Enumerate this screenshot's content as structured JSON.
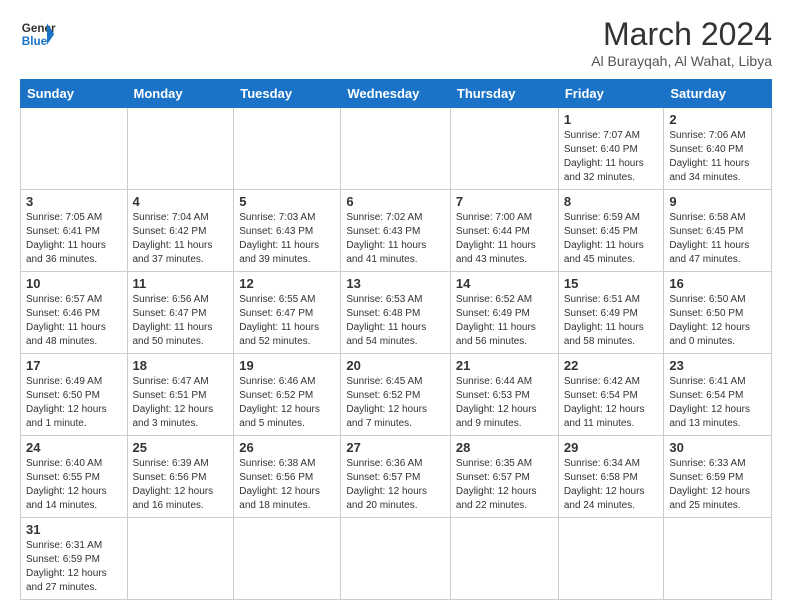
{
  "header": {
    "logo_general": "General",
    "logo_blue": "Blue",
    "month_title": "March 2024",
    "subtitle": "Al Burayqah, Al Wahat, Libya"
  },
  "days_of_week": [
    "Sunday",
    "Monday",
    "Tuesday",
    "Wednesday",
    "Thursday",
    "Friday",
    "Saturday"
  ],
  "weeks": [
    [
      {
        "day": null
      },
      {
        "day": null
      },
      {
        "day": null
      },
      {
        "day": null
      },
      {
        "day": null
      },
      {
        "day": 1,
        "sunrise": "7:07 AM",
        "sunset": "6:40 PM",
        "daylight": "11 hours and 32 minutes."
      },
      {
        "day": 2,
        "sunrise": "7:06 AM",
        "sunset": "6:40 PM",
        "daylight": "11 hours and 34 minutes."
      }
    ],
    [
      {
        "day": 3,
        "sunrise": "7:05 AM",
        "sunset": "6:41 PM",
        "daylight": "11 hours and 36 minutes."
      },
      {
        "day": 4,
        "sunrise": "7:04 AM",
        "sunset": "6:42 PM",
        "daylight": "11 hours and 37 minutes."
      },
      {
        "day": 5,
        "sunrise": "7:03 AM",
        "sunset": "6:43 PM",
        "daylight": "11 hours and 39 minutes."
      },
      {
        "day": 6,
        "sunrise": "7:02 AM",
        "sunset": "6:43 PM",
        "daylight": "11 hours and 41 minutes."
      },
      {
        "day": 7,
        "sunrise": "7:00 AM",
        "sunset": "6:44 PM",
        "daylight": "11 hours and 43 minutes."
      },
      {
        "day": 8,
        "sunrise": "6:59 AM",
        "sunset": "6:45 PM",
        "daylight": "11 hours and 45 minutes."
      },
      {
        "day": 9,
        "sunrise": "6:58 AM",
        "sunset": "6:45 PM",
        "daylight": "11 hours and 47 minutes."
      }
    ],
    [
      {
        "day": 10,
        "sunrise": "6:57 AM",
        "sunset": "6:46 PM",
        "daylight": "11 hours and 48 minutes."
      },
      {
        "day": 11,
        "sunrise": "6:56 AM",
        "sunset": "6:47 PM",
        "daylight": "11 hours and 50 minutes."
      },
      {
        "day": 12,
        "sunrise": "6:55 AM",
        "sunset": "6:47 PM",
        "daylight": "11 hours and 52 minutes."
      },
      {
        "day": 13,
        "sunrise": "6:53 AM",
        "sunset": "6:48 PM",
        "daylight": "11 hours and 54 minutes."
      },
      {
        "day": 14,
        "sunrise": "6:52 AM",
        "sunset": "6:49 PM",
        "daylight": "11 hours and 56 minutes."
      },
      {
        "day": 15,
        "sunrise": "6:51 AM",
        "sunset": "6:49 PM",
        "daylight": "11 hours and 58 minutes."
      },
      {
        "day": 16,
        "sunrise": "6:50 AM",
        "sunset": "6:50 PM",
        "daylight": "12 hours and 0 minutes."
      }
    ],
    [
      {
        "day": 17,
        "sunrise": "6:49 AM",
        "sunset": "6:50 PM",
        "daylight": "12 hours and 1 minute."
      },
      {
        "day": 18,
        "sunrise": "6:47 AM",
        "sunset": "6:51 PM",
        "daylight": "12 hours and 3 minutes."
      },
      {
        "day": 19,
        "sunrise": "6:46 AM",
        "sunset": "6:52 PM",
        "daylight": "12 hours and 5 minutes."
      },
      {
        "day": 20,
        "sunrise": "6:45 AM",
        "sunset": "6:52 PM",
        "daylight": "12 hours and 7 minutes."
      },
      {
        "day": 21,
        "sunrise": "6:44 AM",
        "sunset": "6:53 PM",
        "daylight": "12 hours and 9 minutes."
      },
      {
        "day": 22,
        "sunrise": "6:42 AM",
        "sunset": "6:54 PM",
        "daylight": "12 hours and 11 minutes."
      },
      {
        "day": 23,
        "sunrise": "6:41 AM",
        "sunset": "6:54 PM",
        "daylight": "12 hours and 13 minutes."
      }
    ],
    [
      {
        "day": 24,
        "sunrise": "6:40 AM",
        "sunset": "6:55 PM",
        "daylight": "12 hours and 14 minutes."
      },
      {
        "day": 25,
        "sunrise": "6:39 AM",
        "sunset": "6:56 PM",
        "daylight": "12 hours and 16 minutes."
      },
      {
        "day": 26,
        "sunrise": "6:38 AM",
        "sunset": "6:56 PM",
        "daylight": "12 hours and 18 minutes."
      },
      {
        "day": 27,
        "sunrise": "6:36 AM",
        "sunset": "6:57 PM",
        "daylight": "12 hours and 20 minutes."
      },
      {
        "day": 28,
        "sunrise": "6:35 AM",
        "sunset": "6:57 PM",
        "daylight": "12 hours and 22 minutes."
      },
      {
        "day": 29,
        "sunrise": "6:34 AM",
        "sunset": "6:58 PM",
        "daylight": "12 hours and 24 minutes."
      },
      {
        "day": 30,
        "sunrise": "6:33 AM",
        "sunset": "6:59 PM",
        "daylight": "12 hours and 25 minutes."
      }
    ],
    [
      {
        "day": 31,
        "sunrise": "6:31 AM",
        "sunset": "6:59 PM",
        "daylight": "12 hours and 27 minutes."
      },
      {
        "day": null
      },
      {
        "day": null
      },
      {
        "day": null
      },
      {
        "day": null
      },
      {
        "day": null
      },
      {
        "day": null
      }
    ]
  ]
}
